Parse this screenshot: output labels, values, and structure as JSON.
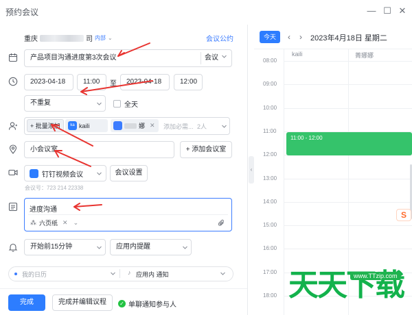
{
  "window": {
    "title": "预约会议",
    "min_icon": "minimize-icon",
    "max_icon": "maximize-icon",
    "close_icon": "close-icon"
  },
  "form": {
    "org_name_prefix": "重庆",
    "org_name_suffix": "司",
    "org_tag": "内部",
    "meeting_link": "会议公约",
    "title": "产品项目沟通进度第3次会议",
    "title_type": "会议",
    "start_date": "2023-04-18",
    "start_time": "11:00",
    "to": "至",
    "end_date": "2023-04-18",
    "end_time": "12:00",
    "repeat": "不重复",
    "all_day": "全天",
    "batch_add": "+ 批量添加",
    "participants": [
      {
        "avatar": "ka",
        "name": "kaili"
      },
      {
        "avatar": "",
        "name": "娜"
      }
    ],
    "participant_placeholder": "添加必需...",
    "participant_count": "2人",
    "room": "小会议室",
    "add_room": "+ 添加会议室",
    "video_app": "钉钉视频会议",
    "video_settings": "会议设置",
    "meeting_id": "会议号：723 214 22338",
    "description": "进度沟通",
    "attachment": "六页纸",
    "reminder": "开始前15分钟",
    "reminder_type": "应用内提醒",
    "calendar": "我的日历",
    "notify_type": "应用内 通知",
    "done": "完成",
    "done_edit": "完成并编辑议程",
    "single_notify": "单聊通知参与人"
  },
  "calendar": {
    "today": "今天",
    "date_label": "2023年4月18日 星期二",
    "columns": [
      "kaili",
      "菁娜娜"
    ],
    "hours": [
      "08:00",
      "09:00",
      "10:00",
      "11:00",
      "12:00",
      "13:00",
      "14:00",
      "15:00",
      "16:00",
      "17:00",
      "18:00"
    ],
    "event_time": "11:00 - 12:00",
    "event_color": "#35c36b"
  },
  "watermark": {
    "ime_badge": "S",
    "site_logo": "天天下载",
    "site_url": "www.TTzip.com"
  },
  "colors": {
    "accent": "#2d7dff",
    "annotation_arrow": "#e8332f"
  }
}
